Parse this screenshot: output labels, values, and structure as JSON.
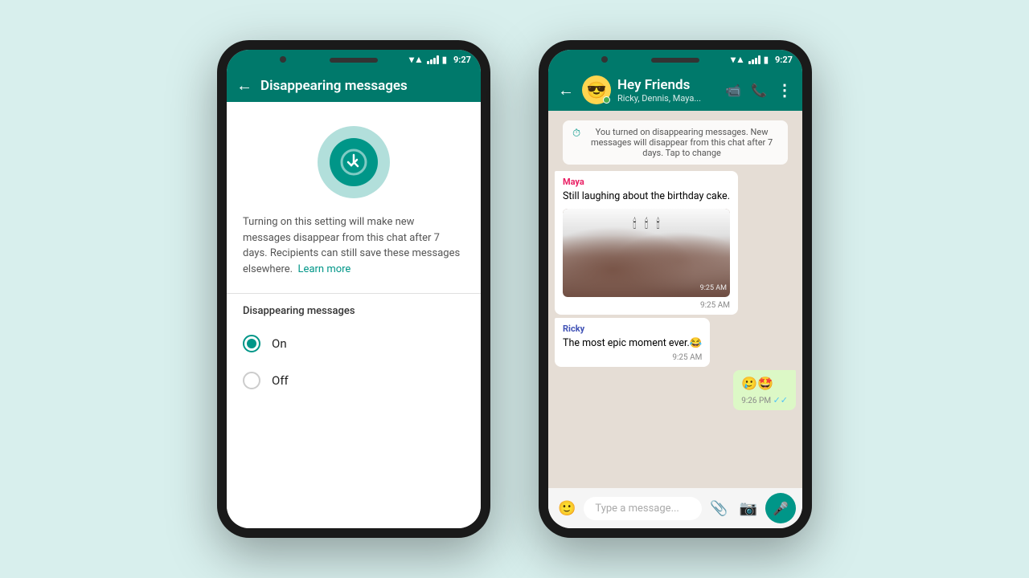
{
  "background_color": "#d8efed",
  "phone_left": {
    "status_bar": {
      "time": "9:27"
    },
    "header": {
      "back_label": "←",
      "title": "Disappearing messages"
    },
    "icon_alt": "timer-checkmark",
    "description": "Turning on this setting will make new messages disappear from this chat after 7 days. Recipients can still save these messages elsewhere.",
    "learn_more_label": "Learn more",
    "section_title": "Disappearing messages",
    "options": [
      {
        "label": "On",
        "selected": true
      },
      {
        "label": "Off",
        "selected": false
      }
    ]
  },
  "phone_right": {
    "status_bar": {
      "time": "9:27"
    },
    "header": {
      "back_label": "←",
      "group_emoji": "😎",
      "title": "Hey Friends",
      "subtitle": "Ricky, Dennis, Maya...",
      "icon_video": "📹",
      "icon_phone": "📞",
      "icon_more": "⋮"
    },
    "system_message": "You turned on disappearing messages. New messages will disappear from this chat after 7 days. Tap to change",
    "messages": [
      {
        "type": "received",
        "sender": "Maya",
        "sender_color": "maya",
        "text": "Still laughing about the birthday cake.",
        "time": "9:25 AM",
        "has_image": true
      },
      {
        "type": "received",
        "sender": "Ricky",
        "sender_color": "ricky",
        "text": "The most epic moment ever.😂",
        "time": "9:25 AM",
        "has_image": false
      },
      {
        "type": "sent",
        "sender": "",
        "text": "🥲🤩",
        "time": "9:26 PM",
        "double_check": "✓✓"
      }
    ],
    "input_placeholder": "Type a message..."
  }
}
